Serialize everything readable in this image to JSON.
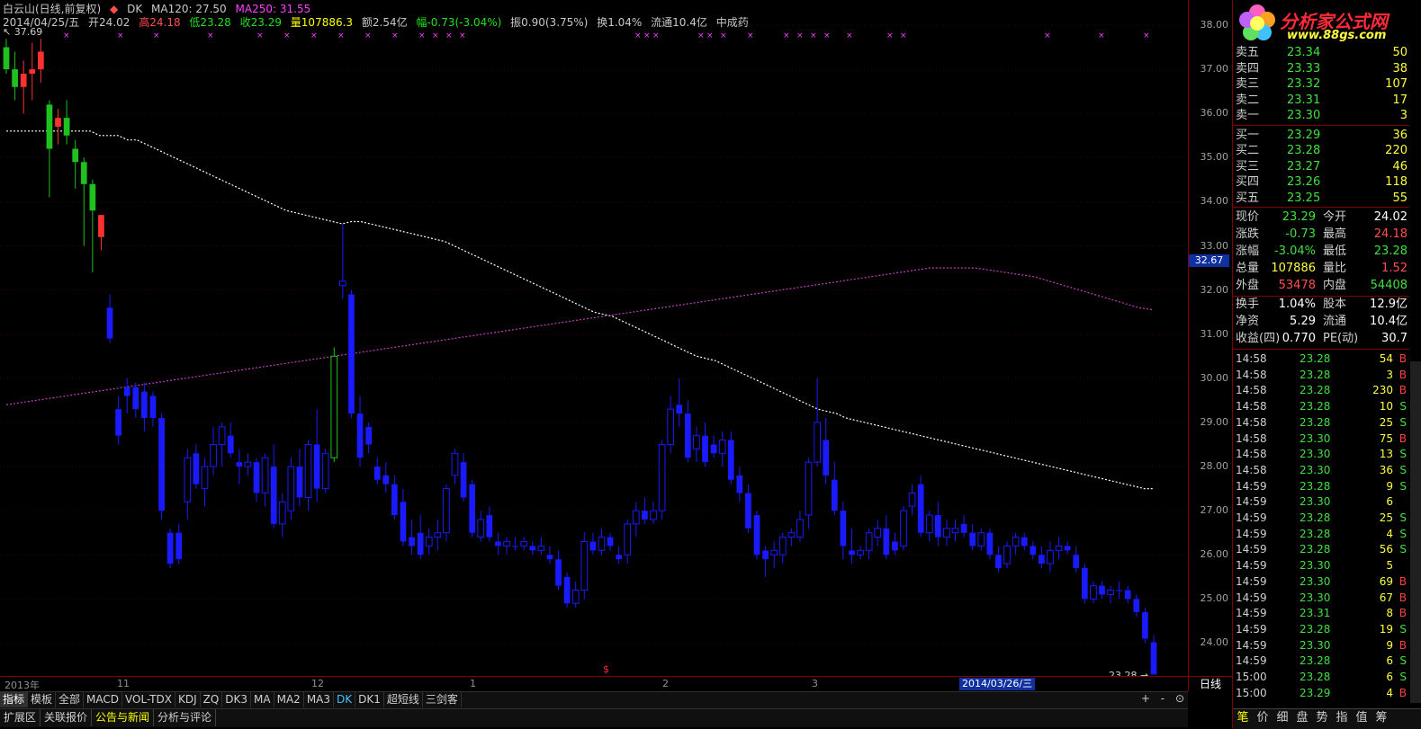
{
  "header": {
    "title": "白云山(日线,前复权)",
    "dk_label": "DK",
    "ma120": "MA120: 27.50",
    "ma250": "MA250: 31.55",
    "date": "2014/04/25/五",
    "open": "开24.02",
    "high": "高24.18",
    "low": "低23.28",
    "close": "收23.29",
    "volume": "量107886.3",
    "amount": "额2.54亿",
    "change": "幅-0.73(-3.04%)",
    "amplitude": "振0.90(3.75%)",
    "turnover": "换1.04%",
    "float": "流通10.4亿",
    "sector": "中成药"
  },
  "chart": {
    "high_marker": "37.69",
    "last_marker": "23.28",
    "cursor_price": "32.67",
    "cursor_date": "2014/03/26/三",
    "period": "日线",
    "price_ticks": [
      "38.00",
      "37.00",
      "36.00",
      "35.00",
      "34.00",
      "33.00",
      "32.00",
      "31.00",
      "30.00",
      "29.00",
      "28.00",
      "27.00",
      "26.00",
      "25.00",
      "24.00"
    ],
    "date_labels": [
      "2013年",
      "11",
      "12",
      "1",
      "2",
      "3"
    ],
    "s_marker": "$"
  },
  "chart_data": {
    "type": "candlestick",
    "ylim": [
      23.0,
      38.4
    ],
    "ohlc": [
      [
        37.5,
        37.69,
        36.9,
        37.0
      ],
      [
        37.0,
        37.4,
        36.3,
        36.6
      ],
      [
        36.6,
        37.2,
        36.0,
        36.9
      ],
      [
        36.9,
        37.6,
        36.3,
        37.0
      ],
      [
        37.0,
        37.69,
        36.7,
        37.4
      ],
      [
        36.2,
        36.3,
        34.1,
        35.2
      ],
      [
        35.7,
        36.1,
        35.3,
        35.9
      ],
      [
        35.9,
        36.3,
        35.3,
        35.5
      ],
      [
        35.2,
        35.4,
        34.3,
        34.9
      ],
      [
        34.9,
        35.0,
        33.0,
        34.4
      ],
      [
        34.4,
        34.5,
        32.4,
        33.8
      ],
      [
        33.2,
        33.7,
        32.9,
        33.7
      ],
      [
        31.6,
        31.9,
        30.8,
        30.9
      ],
      [
        29.3,
        29.6,
        28.5,
        28.7
      ],
      [
        29.8,
        30.0,
        29.2,
        29.6
      ],
      [
        29.8,
        29.9,
        29.1,
        29.3
      ],
      [
        29.7,
        29.9,
        28.8,
        29.1
      ],
      [
        29.6,
        29.7,
        28.9,
        29.1
      ],
      [
        29.1,
        29.2,
        26.8,
        27.0
      ],
      [
        26.5,
        26.6,
        25.7,
        25.8
      ],
      [
        26.5,
        26.7,
        25.8,
        25.9
      ],
      [
        27.2,
        28.4,
        26.8,
        28.2
      ],
      [
        28.3,
        28.5,
        27.5,
        27.6
      ],
      [
        27.5,
        28.2,
        27.1,
        28.0
      ],
      [
        28.0,
        28.9,
        27.8,
        28.5
      ],
      [
        28.5,
        29.0,
        28.0,
        28.9
      ],
      [
        28.7,
        29.0,
        28.2,
        28.3
      ],
      [
        28.1,
        28.4,
        27.6,
        28.0
      ],
      [
        28.0,
        28.3,
        27.8,
        28.1
      ],
      [
        28.1,
        28.2,
        27.2,
        27.4
      ],
      [
        27.4,
        28.3,
        27.1,
        28.2
      ],
      [
        28.0,
        28.5,
        26.6,
        26.7
      ],
      [
        26.7,
        27.4,
        26.4,
        27.2
      ],
      [
        27.0,
        28.2,
        26.8,
        28.0
      ],
      [
        28.0,
        28.4,
        27.1,
        27.3
      ],
      [
        27.3,
        28.6,
        27.0,
        28.5
      ],
      [
        28.5,
        29.3,
        27.2,
        27.5
      ],
      [
        27.5,
        28.4,
        27.4,
        28.3
      ],
      [
        28.2,
        30.7,
        28.1,
        30.5
      ],
      [
        32.1,
        33.5,
        31.8,
        32.2
      ],
      [
        31.9,
        32.0,
        29.1,
        29.2
      ],
      [
        29.2,
        29.6,
        28.0,
        28.2
      ],
      [
        28.9,
        29.0,
        28.3,
        28.5
      ],
      [
        28.0,
        28.2,
        27.6,
        27.7
      ],
      [
        27.8,
        28.1,
        27.4,
        27.6
      ],
      [
        27.6,
        27.8,
        26.8,
        26.9
      ],
      [
        27.2,
        27.5,
        26.2,
        26.3
      ],
      [
        26.4,
        26.8,
        26.0,
        26.2
      ],
      [
        26.5,
        26.9,
        25.9,
        26.0
      ],
      [
        26.2,
        26.6,
        26.0,
        26.4
      ],
      [
        26.4,
        26.8,
        26.1,
        26.5
      ],
      [
        26.5,
        27.6,
        26.3,
        27.5
      ],
      [
        27.8,
        28.4,
        27.6,
        28.3
      ],
      [
        28.1,
        28.3,
        27.2,
        27.3
      ],
      [
        27.6,
        27.7,
        26.4,
        26.5
      ],
      [
        26.4,
        27.0,
        26.3,
        26.8
      ],
      [
        26.9,
        27.1,
        26.3,
        26.4
      ],
      [
        26.3,
        26.5,
        26.0,
        26.2
      ],
      [
        26.2,
        26.4,
        26.0,
        26.3
      ],
      [
        26.2,
        26.4,
        26.1,
        26.2
      ],
      [
        26.2,
        26.4,
        26.1,
        26.3
      ],
      [
        26.2,
        26.3,
        26.0,
        26.1
      ],
      [
        26.1,
        26.4,
        26.0,
        26.2
      ],
      [
        26.0,
        26.2,
        25.8,
        25.9
      ],
      [
        25.9,
        26.1,
        25.2,
        25.3
      ],
      [
        25.5,
        25.6,
        24.8,
        24.9
      ],
      [
        24.9,
        25.4,
        24.8,
        25.2
      ],
      [
        25.2,
        26.5,
        25.0,
        26.3
      ],
      [
        26.3,
        26.5,
        26.0,
        26.1
      ],
      [
        26.1,
        26.6,
        26.0,
        26.4
      ],
      [
        26.4,
        26.5,
        26.1,
        26.2
      ],
      [
        26.0,
        26.2,
        25.8,
        25.9
      ],
      [
        26.0,
        26.8,
        25.8,
        26.7
      ],
      [
        26.7,
        27.2,
        26.4,
        27.0
      ],
      [
        27.0,
        27.3,
        26.7,
        26.8
      ],
      [
        26.8,
        27.2,
        26.7,
        27.0
      ],
      [
        27.0,
        28.6,
        26.8,
        28.5
      ],
      [
        28.5,
        29.6,
        28.3,
        29.3
      ],
      [
        29.4,
        30.0,
        28.9,
        29.2
      ],
      [
        29.2,
        29.5,
        28.1,
        28.2
      ],
      [
        28.4,
        28.9,
        28.1,
        28.7
      ],
      [
        28.7,
        29.0,
        28.0,
        28.1
      ],
      [
        28.5,
        28.7,
        28.2,
        28.3
      ],
      [
        28.3,
        28.8,
        28.0,
        28.6
      ],
      [
        28.6,
        28.8,
        27.6,
        27.7
      ],
      [
        27.8,
        28.0,
        27.2,
        27.4
      ],
      [
        27.4,
        27.6,
        26.5,
        26.6
      ],
      [
        26.9,
        27.0,
        25.9,
        26.0
      ],
      [
        26.1,
        26.2,
        25.5,
        25.9
      ],
      [
        26.0,
        26.3,
        25.7,
        26.1
      ],
      [
        26.0,
        26.5,
        25.8,
        26.4
      ],
      [
        26.4,
        26.6,
        26.2,
        26.5
      ],
      [
        26.4,
        27.0,
        26.3,
        26.8
      ],
      [
        26.9,
        28.2,
        26.6,
        28.1
      ],
      [
        28.1,
        30.0,
        28.0,
        29.0
      ],
      [
        28.6,
        29.1,
        27.6,
        27.8
      ],
      [
        27.7,
        28.1,
        26.9,
        27.0
      ],
      [
        27.0,
        27.2,
        25.9,
        26.2
      ],
      [
        26.1,
        26.6,
        25.8,
        26.0
      ],
      [
        26.0,
        26.2,
        25.9,
        26.1
      ],
      [
        26.1,
        26.6,
        25.9,
        26.5
      ],
      [
        26.4,
        26.8,
        26.2,
        26.6
      ],
      [
        26.6,
        26.9,
        25.9,
        26.0
      ],
      [
        26.3,
        26.5,
        26.0,
        26.1
      ],
      [
        26.2,
        27.1,
        26.1,
        27.0
      ],
      [
        27.1,
        27.6,
        26.9,
        27.4
      ],
      [
        27.6,
        27.8,
        26.4,
        26.5
      ],
      [
        26.5,
        27.0,
        26.3,
        26.9
      ],
      [
        26.9,
        27.2,
        26.2,
        26.4
      ],
      [
        26.4,
        26.8,
        26.2,
        26.6
      ],
      [
        26.5,
        26.8,
        26.3,
        26.6
      ],
      [
        26.7,
        26.9,
        26.4,
        26.5
      ],
      [
        26.5,
        26.7,
        26.1,
        26.2
      ],
      [
        26.2,
        26.6,
        26.1,
        26.5
      ],
      [
        26.5,
        26.6,
        25.9,
        26.0
      ],
      [
        26.0,
        26.2,
        25.6,
        25.7
      ],
      [
        25.8,
        26.3,
        25.7,
        26.2
      ],
      [
        26.2,
        26.5,
        26.0,
        26.4
      ],
      [
        26.4,
        26.5,
        26.1,
        26.2
      ],
      [
        26.2,
        26.3,
        25.9,
        26.0
      ],
      [
        26.0,
        26.2,
        25.7,
        25.8
      ],
      [
        25.8,
        26.3,
        25.6,
        26.1
      ],
      [
        26.1,
        26.4,
        25.9,
        26.2
      ],
      [
        26.2,
        26.3,
        26.0,
        26.1
      ],
      [
        26.0,
        26.2,
        25.6,
        25.7
      ],
      [
        25.7,
        25.8,
        24.9,
        25.0
      ],
      [
        25.0,
        25.4,
        24.9,
        25.3
      ],
      [
        25.3,
        25.4,
        25.0,
        25.1
      ],
      [
        25.1,
        25.3,
        24.9,
        25.2
      ],
      [
        25.2,
        25.4,
        25.0,
        25.2
      ],
      [
        25.2,
        25.3,
        24.9,
        25.0
      ],
      [
        25.0,
        25.1,
        24.6,
        24.7
      ],
      [
        24.7,
        24.8,
        24.0,
        24.1
      ],
      [
        24.02,
        24.18,
        23.28,
        23.29
      ]
    ],
    "ma120": [
      35.6,
      35.6,
      35.6,
      35.6,
      35.6,
      35.6,
      35.6,
      35.6,
      35.6,
      35.6,
      35.5,
      35.5,
      35.5,
      35.4,
      35.4,
      35.3,
      35.2,
      35.1,
      35.0,
      34.9,
      34.8,
      34.7,
      34.6,
      34.5,
      34.4,
      34.3,
      34.2,
      34.1,
      34.0,
      33.9,
      33.8,
      33.75,
      33.7,
      33.65,
      33.6,
      33.55,
      33.5,
      33.55,
      33.55,
      33.5,
      33.45,
      33.4,
      33.35,
      33.3,
      33.25,
      33.2,
      33.15,
      33.1,
      33.0,
      32.9,
      32.8,
      32.7,
      32.6,
      32.5,
      32.4,
      32.3,
      32.2,
      32.1,
      32.0,
      31.9,
      31.8,
      31.7,
      31.6,
      31.5,
      31.45,
      31.4,
      31.3,
      31.2,
      31.1,
      31.0,
      30.9,
      30.8,
      30.7,
      30.6,
      30.5,
      30.45,
      30.4,
      30.3,
      30.2,
      30.1,
      30.0,
      29.9,
      29.8,
      29.7,
      29.6,
      29.5,
      29.4,
      29.3,
      29.25,
      29.2,
      29.1,
      29.05,
      29.0,
      28.95,
      28.9,
      28.85,
      28.8,
      28.75,
      28.7,
      28.65,
      28.6,
      28.55,
      28.5,
      28.45,
      28.4,
      28.35,
      28.3,
      28.25,
      28.2,
      28.15,
      28.1,
      28.05,
      28.0,
      27.95,
      27.9,
      27.85,
      27.8,
      27.75,
      27.7,
      27.65,
      27.6,
      27.55,
      27.5,
      27.5
    ],
    "ma250": [
      29.4,
      29.45,
      29.5,
      29.55,
      29.6,
      29.65,
      29.7,
      29.75,
      29.8,
      29.85,
      29.9,
      29.95,
      30.0,
      30.05,
      30.1,
      30.15,
      30.2,
      30.25,
      30.3,
      30.35,
      30.4,
      30.45,
      30.5,
      30.55,
      30.6,
      30.65,
      30.7,
      30.75,
      30.8,
      30.85,
      30.9,
      30.95,
      31.0,
      31.05,
      31.1,
      31.15,
      31.2,
      31.25,
      31.3,
      31.35,
      31.4,
      31.45,
      31.5,
      31.55,
      31.6,
      31.65,
      31.7,
      31.75,
      31.8,
      31.85,
      31.9,
      31.95,
      32.0,
      32.05,
      32.1,
      32.15,
      32.2,
      32.25,
      32.3,
      32.35,
      32.4,
      32.45,
      32.5,
      32.5,
      32.5,
      32.5,
      32.45,
      32.4,
      32.35,
      32.3,
      32.2,
      32.1,
      32.0,
      31.9,
      31.8,
      31.7,
      31.6,
      31.55
    ]
  },
  "tabs": [
    "指标",
    "模板",
    "全部",
    "MACD",
    "VOL-TDX",
    "KDJ",
    "ZQ",
    "DK3",
    "MA",
    "MA2",
    "MA3",
    "DK",
    "DK1",
    "超短线",
    "三剑客"
  ],
  "tab_controls": {
    "add": "+",
    "sub": "-",
    "close": "⊙"
  },
  "bottom_tabs": [
    "扩展区",
    "关联报价",
    "公告与新闻",
    "分析与评论"
  ],
  "logo": {
    "text": "分析家公式网",
    "url": "www.88gs.com"
  },
  "quotes": {
    "sell": [
      {
        "label": "卖五",
        "price": "23.34",
        "vol": "50"
      },
      {
        "label": "卖四",
        "price": "23.33",
        "vol": "38"
      },
      {
        "label": "卖三",
        "price": "23.32",
        "vol": "107"
      },
      {
        "label": "卖二",
        "price": "23.31",
        "vol": "17"
      },
      {
        "label": "卖一",
        "price": "23.30",
        "vol": "3"
      }
    ],
    "buy": [
      {
        "label": "买一",
        "price": "23.29",
        "vol": "36"
      },
      {
        "label": "买二",
        "price": "23.28",
        "vol": "220"
      },
      {
        "label": "买三",
        "price": "23.27",
        "vol": "46"
      },
      {
        "label": "买四",
        "price": "23.26",
        "vol": "118"
      },
      {
        "label": "买五",
        "price": "23.25",
        "vol": "55"
      }
    ]
  },
  "stats": [
    {
      "l1": "现价",
      "v1": "23.29",
      "c1": "#40e040",
      "l2": "今开",
      "v2": "24.02",
      "c2": "#ffffff"
    },
    {
      "l1": "涨跌",
      "v1": "-0.73",
      "c1": "#40e040",
      "l2": "最高",
      "v2": "24.18",
      "c2": "#ff5050"
    },
    {
      "l1": "涨幅",
      "v1": "-3.04%",
      "c1": "#40e040",
      "l2": "最低",
      "v2": "23.28",
      "c2": "#40e040"
    },
    {
      "l1": "总量",
      "v1": "107886",
      "c1": "#ffff40",
      "l2": "量比",
      "v2": "1.52",
      "c2": "#ff5050"
    },
    {
      "l1": "外盘",
      "v1": "53478",
      "c1": "#ff5050",
      "l2": "内盘",
      "v2": "54408",
      "c2": "#40e040"
    },
    {
      "l1": "换手",
      "v1": "1.04%",
      "c1": "#ffffff",
      "l2": "股本",
      "v2": "12.9亿",
      "c2": "#ffffff"
    },
    {
      "l1": "净资",
      "v1": "5.29",
      "c1": "#ffffff",
      "l2": "流通",
      "v2": "10.4亿",
      "c2": "#ffffff"
    },
    {
      "l1": "收益(四)",
      "v1": "0.770",
      "c1": "#ffffff",
      "l2": "PE(动)",
      "v2": "30.7",
      "c2": "#ffffff"
    }
  ],
  "ticks": [
    {
      "time": "14:58",
      "price": "23.28",
      "vol": "54",
      "side": "B"
    },
    {
      "time": "14:58",
      "price": "23.28",
      "vol": "3",
      "side": "B"
    },
    {
      "time": "14:58",
      "price": "23.28",
      "vol": "230",
      "side": "B"
    },
    {
      "time": "14:58",
      "price": "23.28",
      "vol": "10",
      "side": "S"
    },
    {
      "time": "14:58",
      "price": "23.28",
      "vol": "25",
      "side": "S"
    },
    {
      "time": "14:58",
      "price": "23.30",
      "vol": "75",
      "side": "B"
    },
    {
      "time": "14:58",
      "price": "23.30",
      "vol": "13",
      "side": "S"
    },
    {
      "time": "14:58",
      "price": "23.30",
      "vol": "36",
      "side": "S"
    },
    {
      "time": "14:59",
      "price": "23.28",
      "vol": "9",
      "side": "S"
    },
    {
      "time": "14:59",
      "price": "23.30",
      "vol": "6",
      "side": ""
    },
    {
      "time": "14:59",
      "price": "23.28",
      "vol": "25",
      "side": "S"
    },
    {
      "time": "14:59",
      "price": "23.28",
      "vol": "4",
      "side": "S"
    },
    {
      "time": "14:59",
      "price": "23.28",
      "vol": "56",
      "side": "S"
    },
    {
      "time": "14:59",
      "price": "23.30",
      "vol": "5",
      "side": ""
    },
    {
      "time": "14:59",
      "price": "23.30",
      "vol": "69",
      "side": "B"
    },
    {
      "time": "14:59",
      "price": "23.30",
      "vol": "67",
      "side": "B"
    },
    {
      "time": "14:59",
      "price": "23.31",
      "vol": "8",
      "side": "B"
    },
    {
      "time": "14:59",
      "price": "23.28",
      "vol": "19",
      "side": "S"
    },
    {
      "time": "14:59",
      "price": "23.30",
      "vol": "9",
      "side": "B"
    },
    {
      "time": "14:59",
      "price": "23.28",
      "vol": "6",
      "side": "S"
    },
    {
      "time": "15:00",
      "price": "23.28",
      "vol": "6",
      "side": "S"
    },
    {
      "time": "15:00",
      "price": "23.29",
      "vol": "4",
      "side": "B"
    }
  ],
  "right_tabs": [
    "笔",
    "价",
    "细",
    "盘",
    "势",
    "指",
    "值",
    "筹"
  ],
  "colors": {
    "up": "#ff3030",
    "down": "#20c020",
    "blue": "#1a1aff",
    "ma120": "#ffffff",
    "ma250": "#c040c0",
    "grid": "#800000",
    "marker": "#ff40ff"
  }
}
